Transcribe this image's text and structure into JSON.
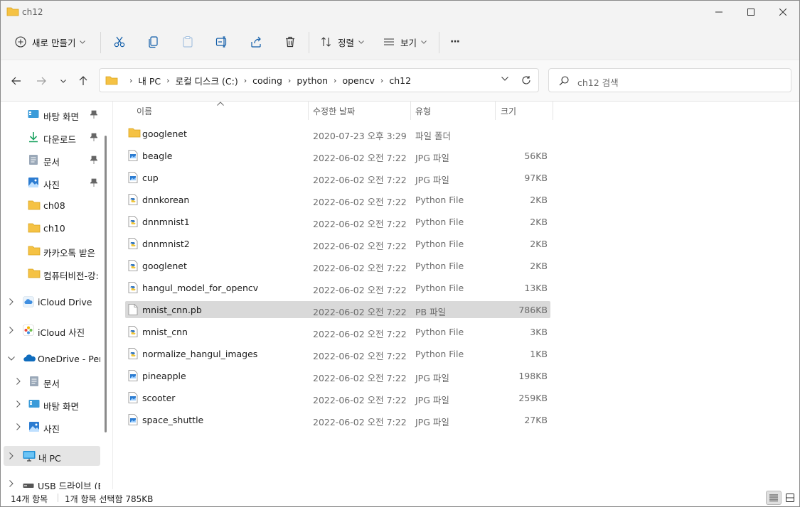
{
  "window": {
    "title": "ch12"
  },
  "toolbar": {
    "new_label": "새로 만들기",
    "sort_label": "정렬",
    "view_label": "보기",
    "more_label": "···"
  },
  "address": {
    "breadcrumbs": [
      "내 PC",
      "로컬 디스크 (C:)",
      "coding",
      "python",
      "opencv",
      "ch12"
    ]
  },
  "search": {
    "placeholder": "ch12 검색"
  },
  "sidebar": {
    "items": [
      {
        "label": "바탕 화면",
        "icon": "desktop-icon",
        "pinned": true
      },
      {
        "label": "다운로드",
        "icon": "download-icon",
        "pinned": true
      },
      {
        "label": "문서",
        "icon": "documents-icon",
        "pinned": true
      },
      {
        "label": "사진",
        "icon": "pictures-icon",
        "pinned": true
      },
      {
        "label": "ch08",
        "icon": "folder-icon"
      },
      {
        "label": "ch10",
        "icon": "folder-icon"
      },
      {
        "label": "카카오톡 받은",
        "icon": "folder-icon"
      },
      {
        "label": "컴퓨터비전-강:",
        "icon": "folder-icon"
      },
      {
        "label": "iCloud Drive",
        "icon": "icloud-drive-icon"
      },
      {
        "label": "iCloud 사진",
        "icon": "icloud-photos-icon"
      },
      {
        "label": "OneDrive - Perso",
        "icon": "onedrive-icon"
      },
      {
        "label": "문서",
        "icon": "documents-icon"
      },
      {
        "label": "바탕 화면",
        "icon": "desktop-icon"
      },
      {
        "label": "사진",
        "icon": "pictures-icon"
      },
      {
        "label": "내 PC",
        "icon": "this-pc-icon"
      },
      {
        "label": "USB 드라이브 (E",
        "icon": "usb-drive-icon"
      }
    ]
  },
  "columns": {
    "name": "이름",
    "date": "수정한 날짜",
    "type": "유형",
    "size": "크기"
  },
  "files": [
    {
      "name": "googlenet",
      "date": "2020-07-23 오후 3:29",
      "type": "파일 폴더",
      "size": "",
      "kind": "folder"
    },
    {
      "name": "beagle",
      "date": "2022-06-02 오전 7:22",
      "type": "JPG 파일",
      "size": "56KB",
      "kind": "jpg"
    },
    {
      "name": "cup",
      "date": "2022-06-02 오전 7:22",
      "type": "JPG 파일",
      "size": "97KB",
      "kind": "jpg"
    },
    {
      "name": "dnnkorean",
      "date": "2022-06-02 오전 7:22",
      "type": "Python File",
      "size": "2KB",
      "kind": "py"
    },
    {
      "name": "dnnmnist1",
      "date": "2022-06-02 오전 7:22",
      "type": "Python File",
      "size": "2KB",
      "kind": "py"
    },
    {
      "name": "dnnmnist2",
      "date": "2022-06-02 오전 7:22",
      "type": "Python File",
      "size": "2KB",
      "kind": "py"
    },
    {
      "name": "googlenet",
      "date": "2022-06-02 오전 7:22",
      "type": "Python File",
      "size": "2KB",
      "kind": "py"
    },
    {
      "name": "hangul_model_for_opencv",
      "date": "2022-06-02 오전 7:22",
      "type": "Python File",
      "size": "13KB",
      "kind": "py"
    },
    {
      "name": "mnist_cnn.pb",
      "date": "2022-06-02 오전 7:22",
      "type": "PB 파일",
      "size": "786KB",
      "kind": "blank",
      "selected": true
    },
    {
      "name": "mnist_cnn",
      "date": "2022-06-02 오전 7:22",
      "type": "Python File",
      "size": "3KB",
      "kind": "py"
    },
    {
      "name": "normalize_hangul_images",
      "date": "2022-06-02 오전 7:22",
      "type": "Python File",
      "size": "1KB",
      "kind": "py"
    },
    {
      "name": "pineapple",
      "date": "2022-06-02 오전 7:22",
      "type": "JPG 파일",
      "size": "198KB",
      "kind": "jpg"
    },
    {
      "name": "scooter",
      "date": "2022-06-02 오전 7:22",
      "type": "JPG 파일",
      "size": "259KB",
      "kind": "jpg"
    },
    {
      "name": "space_shuttle",
      "date": "2022-06-02 오전 7:22",
      "type": "JPG 파일",
      "size": "27KB",
      "kind": "jpg"
    }
  ],
  "status": {
    "item_count": "14개 항목",
    "selection": "1개 항목 선택함 785KB"
  },
  "colors": {
    "folder": "#f5c244",
    "accent": "#0067c0",
    "selected_row": "#d9d9d9"
  }
}
